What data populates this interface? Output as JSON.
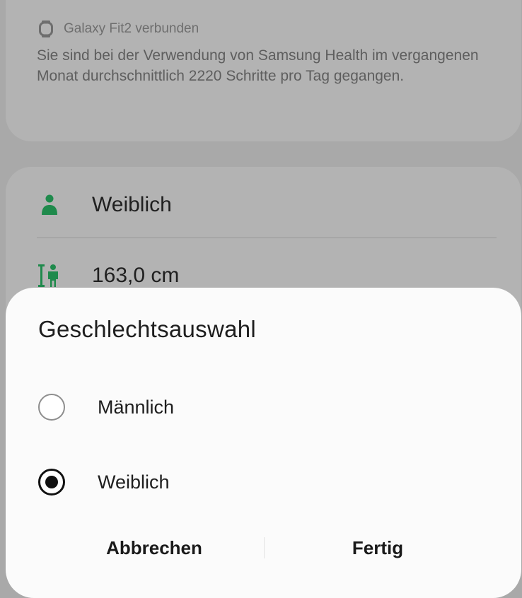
{
  "background": {
    "device": {
      "icon": "watch-icon",
      "text": "Galaxy Fit2 verbunden"
    },
    "summary": "Sie sind bei der Verwendung von Samsung Health im vergangenen Monat durchschnittlich 2220 Schritte pro Tag gegangen.",
    "profile": {
      "gender": {
        "icon": "person-icon",
        "value": "Weiblich"
      },
      "height": {
        "icon": "height-icon",
        "value": "163,0 cm"
      }
    }
  },
  "dialog": {
    "title": "Geschlechtsauswahl",
    "options": [
      {
        "label": "Männlich",
        "selected": false
      },
      {
        "label": "Weiblich",
        "selected": true
      }
    ],
    "cancel_label": "Abbrechen",
    "done_label": "Fertig"
  },
  "colors": {
    "accent_green": "#1f8a4c",
    "dim_background": "#a9a9a9",
    "dialog_background": "#fbfbfb"
  }
}
